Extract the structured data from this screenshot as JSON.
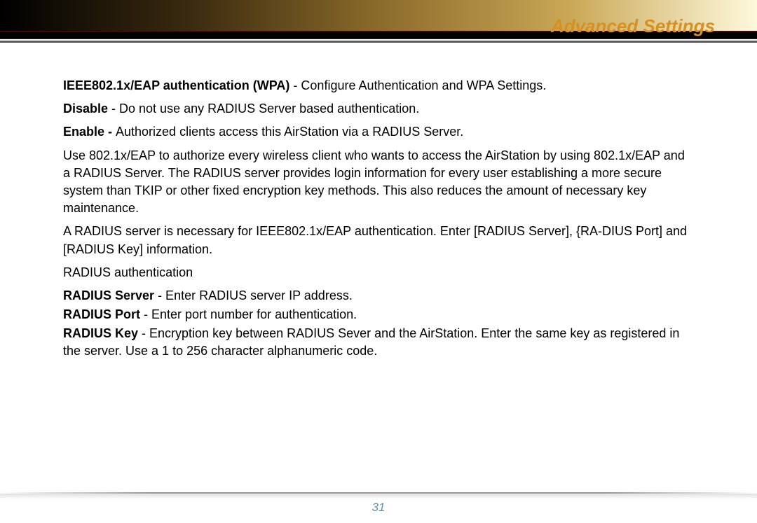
{
  "header": {
    "title": "Advanced Settings"
  },
  "content": {
    "p1_bold": "IEEE802.1x/EAP authentication (WPA)",
    "p1_rest": " - Configure Authentication and WPA Settings.",
    "p2_bold": "Disable",
    "p2_rest": " - Do not use any RADIUS Server based authentication.",
    "p3_bold": "Enable - ",
    "p3_rest": "Authorized clients access this AirStation via a RADIUS Server.",
    "p4": "Use 802.1x/EAP to authorize every wireless client who wants to access the AirStation by using 802.1x/EAP and a RADIUS Server.  The RADIUS server provides login information for every user establishing a more secure system than TKIP or other fixed encryption key methods.  This also reduces the amount of necessary key maintenance.",
    "p5": "A RADIUS server is necessary for IEEE802.1x/EAP authentication. Enter [RADIUS Server], {RA-DIUS Port] and [RADIUS Key] information.",
    "p6": "RADIUS authentication",
    "p7_bold": "RADIUS Server",
    "p7_rest": " - Enter RADIUS server IP address.",
    "p8_bold": "RADIUS Port",
    "p8_rest": " - Enter port number for authentication.",
    "p9_bold": "RADIUS Key",
    "p9_rest": " - Encryption key between RADIUS Sever and the AirStation. Enter the same key as registered in the server.  Use a 1 to 256 character alphanumeric code."
  },
  "footer": {
    "page_number": "31"
  }
}
